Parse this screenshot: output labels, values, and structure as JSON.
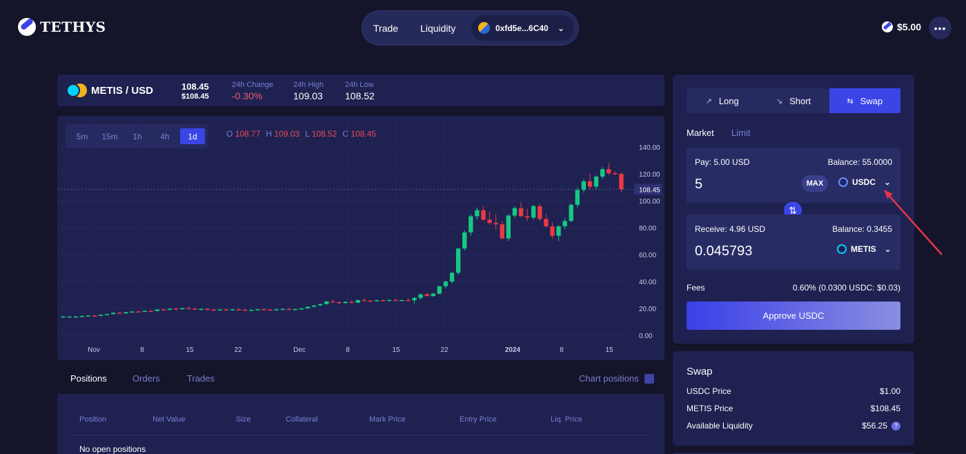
{
  "app": {
    "name": "TETHYS"
  },
  "nav": {
    "trade": "Trade",
    "liquidity": "Liquidity",
    "wallet_address": "0xfd5e...6C40"
  },
  "header": {
    "balance": "$5.00"
  },
  "ticker": {
    "pair": "METIS / USD",
    "price": "108.45",
    "price_usd": "$108.45",
    "change_label": "24h Change",
    "change_value": "-0.30%",
    "high_label": "24h High",
    "high_value": "109.03",
    "low_label": "24h Low",
    "low_value": "108.52"
  },
  "timeframes": [
    "5m",
    "15m",
    "1h",
    "4h",
    "1d"
  ],
  "active_timeframe": "1d",
  "ohlc": {
    "o": "108.77",
    "h": "109.03",
    "l": "108.52",
    "c": "108.45"
  },
  "chart_data": {
    "type": "candlestick",
    "ylim": [
      0,
      140
    ],
    "y_ticks": [
      "140.00",
      "120.00",
      "100.00",
      "80.00",
      "60.00",
      "40.00",
      "20.00",
      "0.00"
    ],
    "x_ticks": [
      "Nov",
      "8",
      "15",
      "22",
      "Dec",
      "8",
      "15",
      "22",
      "2024",
      "8",
      "15"
    ],
    "last_price_label": "108.45",
    "candles": [
      [
        14,
        14.5,
        13.5,
        14
      ],
      [
        14,
        14.5,
        13.5,
        14
      ],
      [
        14,
        14.5,
        13.5,
        14
      ],
      [
        14,
        14.8,
        13.6,
        14.3
      ],
      [
        14.3,
        15,
        13.9,
        14.7
      ],
      [
        14.7,
        15.2,
        14.2,
        14.4
      ],
      [
        14.4,
        15.5,
        14.2,
        15.2
      ],
      [
        15.2,
        16,
        14.9,
        15.8
      ],
      [
        15.8,
        17,
        15.5,
        16.8
      ],
      [
        16.8,
        17.5,
        16.1,
        16.3
      ],
      [
        16.3,
        17.5,
        16,
        17.2
      ],
      [
        17.2,
        18,
        16.8,
        17.7
      ],
      [
        17.7,
        18.2,
        17.1,
        17.4
      ],
      [
        17.4,
        18.5,
        17.2,
        18.2
      ],
      [
        18.2,
        18.8,
        17.6,
        18
      ],
      [
        18,
        19.5,
        17.8,
        19.2
      ],
      [
        19.2,
        20,
        18.7,
        19
      ],
      [
        19,
        20.2,
        18.6,
        19.8
      ],
      [
        19.8,
        20.5,
        19.2,
        19.5
      ],
      [
        19.5,
        20.5,
        19,
        20.2
      ],
      [
        20.2,
        21.5,
        19.6,
        19.8
      ],
      [
        19.8,
        20.5,
        19.2,
        19.3
      ],
      [
        19.3,
        20,
        18.8,
        19.6
      ],
      [
        19.6,
        20.2,
        18.9,
        19.1
      ],
      [
        19.1,
        19.8,
        18.5,
        18.7
      ],
      [
        18.7,
        19.5,
        18.2,
        19.2
      ],
      [
        19.2,
        19.8,
        18.7,
        18.9
      ],
      [
        18.9,
        19.6,
        18.3,
        19.3
      ],
      [
        19.3,
        20,
        18.8,
        19
      ],
      [
        19,
        19.5,
        18.4,
        18.6
      ],
      [
        18.6,
        19.2,
        18.1,
        18.9
      ],
      [
        18.9,
        19.6,
        18.4,
        19.4
      ],
      [
        19.4,
        20.1,
        19,
        19.1
      ],
      [
        19.1,
        19.7,
        18.6,
        18.8
      ],
      [
        18.8,
        19.6,
        18.4,
        19.4
      ],
      [
        19.4,
        20.2,
        18.9,
        19.6
      ],
      [
        19.6,
        20.4,
        19.2,
        19.2
      ],
      [
        19.2,
        19.8,
        18.7,
        19.5
      ],
      [
        19.5,
        20.3,
        19,
        20
      ],
      [
        20,
        21.5,
        19.7,
        21.2
      ],
      [
        21.2,
        22.5,
        20.8,
        22.2
      ],
      [
        22.2,
        23.5,
        21.8,
        23.2
      ],
      [
        23.2,
        25.5,
        22.8,
        25.2
      ],
      [
        25.2,
        26.5,
        24.3,
        24.6
      ],
      [
        24.6,
        25.5,
        23.6,
        24
      ],
      [
        24,
        25.2,
        23.4,
        24.9
      ],
      [
        24.9,
        25.8,
        23.8,
        24.2
      ],
      [
        24.2,
        26.5,
        23.9,
        26.2
      ],
      [
        26.2,
        27.5,
        25.5,
        25.8
      ],
      [
        25.8,
        26.5,
        25.1,
        25.4
      ],
      [
        25.4,
        26.5,
        24.9,
        26.1
      ],
      [
        26.1,
        26.8,
        25.3,
        25.6
      ],
      [
        25.6,
        26.6,
        25.1,
        26.3
      ],
      [
        26.3,
        27,
        25.6,
        25.9
      ],
      [
        25.9,
        26.6,
        25.3,
        26.2
      ],
      [
        26.2,
        27.5,
        25.6,
        26
      ],
      [
        26,
        28.5,
        23.5,
        27.8
      ],
      [
        27.8,
        31,
        26.5,
        30.5
      ],
      [
        30.5,
        31.5,
        28.7,
        29.2
      ],
      [
        29.2,
        31.5,
        28.5,
        31
      ],
      [
        31,
        37,
        30.5,
        36.5
      ],
      [
        36.5,
        40.5,
        35,
        40
      ],
      [
        40,
        47,
        38.5,
        46.5
      ],
      [
        46.5,
        65,
        45,
        64.5
      ],
      [
        64.5,
        78,
        63,
        76.5
      ],
      [
        76.5,
        90,
        74,
        88.5
      ],
      [
        88.5,
        95,
        86,
        93
      ],
      [
        93,
        96,
        85,
        86
      ],
      [
        86,
        92,
        82.5,
        83.5
      ],
      [
        83.5,
        90,
        78.5,
        82.5
      ],
      [
        82.5,
        85,
        71,
        72
      ],
      [
        72,
        90,
        70,
        89
      ],
      [
        89,
        96,
        87,
        94.5
      ],
      [
        94.5,
        99,
        88,
        88.5
      ],
      [
        88.5,
        94,
        85,
        87.5
      ],
      [
        87.5,
        97,
        86,
        96
      ],
      [
        96,
        98,
        85,
        86.5
      ],
      [
        86.5,
        90,
        80,
        81
      ],
      [
        81,
        84,
        72,
        74
      ],
      [
        74,
        82,
        70,
        81
      ],
      [
        81,
        87,
        79,
        85
      ],
      [
        85,
        98,
        84,
        97
      ],
      [
        97,
        110,
        95,
        108
      ],
      [
        108,
        116,
        106,
        114.5
      ],
      [
        114.5,
        120,
        108,
        110.5
      ],
      [
        110.5,
        119,
        108,
        118
      ],
      [
        118,
        125,
        116,
        123.5
      ],
      [
        123.5,
        128,
        119,
        120.5
      ],
      [
        120.5,
        122,
        119,
        120
      ],
      [
        120,
        121,
        106,
        108.5
      ]
    ]
  },
  "positions_tabs": {
    "positions": "Positions",
    "orders": "Orders",
    "trades": "Trades"
  },
  "chart_positions": "Chart positions",
  "positions_table": {
    "headers": [
      "Position",
      "Net Value",
      "Size",
      "Collateral",
      "Mark Price",
      "Entry Price",
      "Liq. Price"
    ],
    "empty": "No open positions"
  },
  "trade": {
    "tabs": [
      "Long",
      "Short",
      "Swap"
    ],
    "active_tab": "Swap",
    "order_types": [
      "Market",
      "Limit"
    ],
    "pay": {
      "label": "Pay: 5.00 USD",
      "balance": "Balance: 55.0000",
      "amount": "5",
      "max": "MAX",
      "token": "USDC"
    },
    "receive": {
      "label": "Receive: 4.96 USD",
      "balance": "Balance: 0.3455",
      "amount": "0.045793",
      "token": "METIS"
    },
    "fees_label": "Fees",
    "fees_value": "0.60%  (0.0300 USDC: $0.03)",
    "approve": "Approve USDC"
  },
  "swap_info": {
    "title": "Swap",
    "rows": [
      {
        "label": "USDC Price",
        "value": "$1.00"
      },
      {
        "label": "METIS Price",
        "value": "$108.45"
      },
      {
        "label": "Available Liquidity",
        "value": "$56.25"
      }
    ]
  },
  "colors": {
    "up": "#16c784",
    "down": "#ea3943",
    "accent": "#3a45e6",
    "annotation": "#e2364a"
  }
}
